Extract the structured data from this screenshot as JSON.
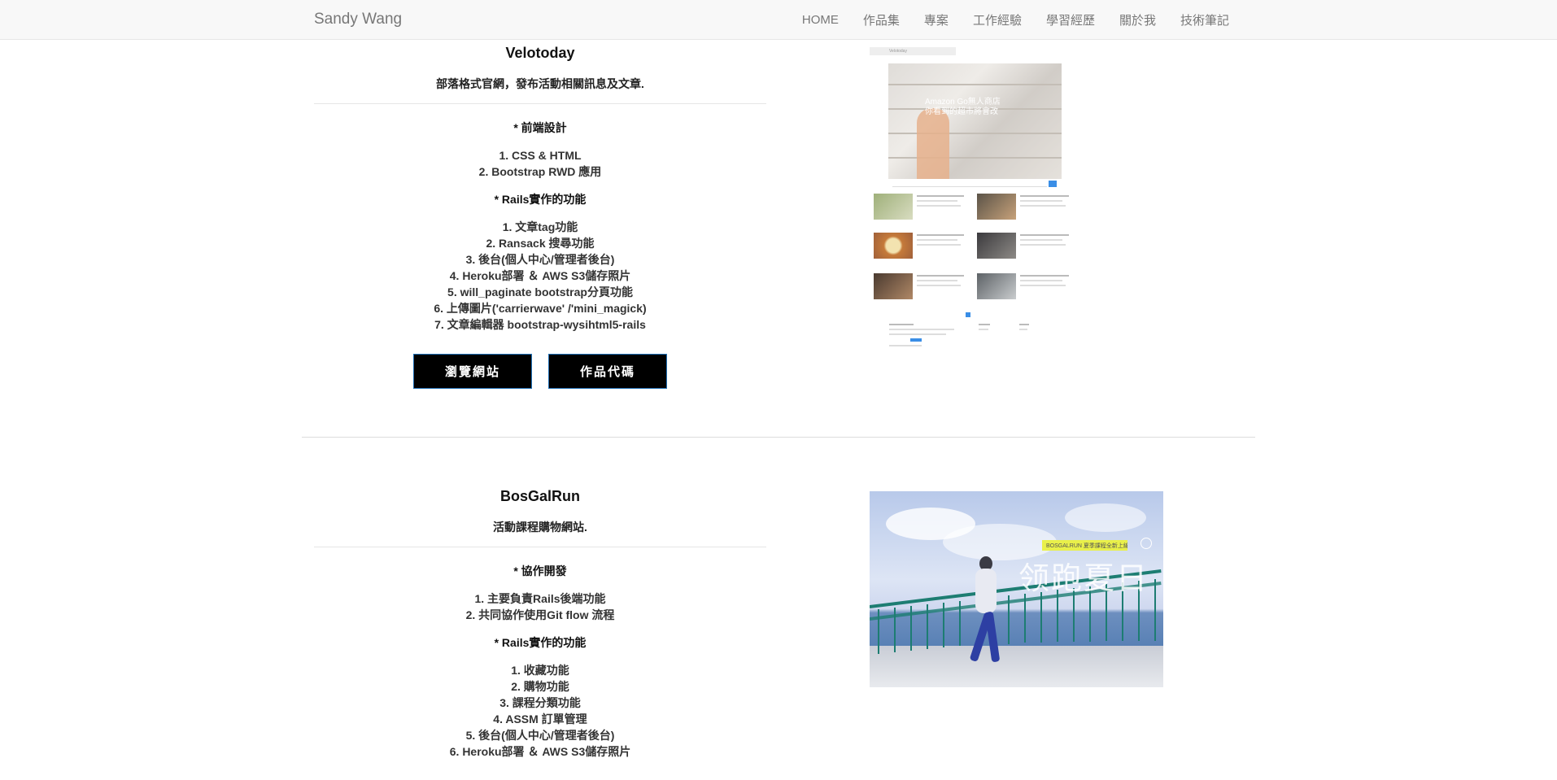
{
  "navbar": {
    "brand": "Sandy Wang",
    "items": [
      "HOME",
      "作品集",
      "專案",
      "工作經驗",
      "學習經歷",
      "關於我",
      "技術筆記"
    ]
  },
  "projects": [
    {
      "title": "Velotoday",
      "description": "部落格式官網，發布活動相關訊息及文章.",
      "sections": [
        {
          "heading": "* 前端設計",
          "items": [
            "1. CSS & HTML",
            "2. Bootstrap RWD 應用"
          ]
        },
        {
          "heading": "* Rails實作的功能",
          "items": [
            "1. 文章tag功能",
            "2. Ransack 搜尋功能",
            "3. 後台(個人中心/管理者後台)",
            "4. Heroku部署 ＆ AWS S3儲存照片",
            "5. will_paginate bootstrap分頁功能",
            "6. 上傳圖片('carrierwave' /'mini_magick)",
            "7. 文章編輯器 bootstrap-wysihtml5-rails"
          ]
        }
      ],
      "buttons": {
        "browse": "瀏覽網站",
        "code": "作品代碼"
      },
      "screenshot": {
        "site_label": "Velotoday",
        "hero_text_1": "Amazon Go無人商店",
        "hero_text_2": "你看到的超市將會改"
      }
    },
    {
      "title": "BosGalRun",
      "description": "活動課程購物網站.",
      "sections": [
        {
          "heading": "* 協作開發",
          "items": [
            "1. 主要負責Rails後端功能",
            "2. 共同協作使用Git flow 流程"
          ]
        },
        {
          "heading": "* Rails實作的功能",
          "items": [
            "1. 收藏功能",
            "2. 購物功能",
            "3. 課程分類功能",
            "4. ASSM 訂單管理",
            "5. 後台(個人中心/管理者後台)",
            "6. Heroku部署 ＆ AWS S3儲存照片"
          ]
        }
      ],
      "image": {
        "banner": "BOSGALRUN 夏季課程全新上線",
        "headline": "领跑夏日"
      }
    }
  ],
  "colors": {
    "nav_bg": "#f8f8f8",
    "button_bg": "#000000",
    "button_border": "#1f6fb5",
    "rail": "#1d7d72"
  }
}
